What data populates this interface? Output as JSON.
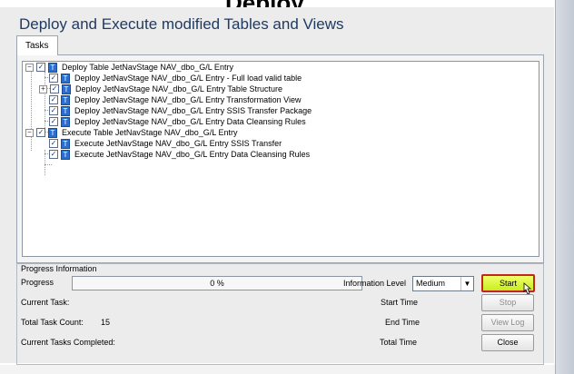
{
  "window": {
    "title": "Deploy and Execute modified Tables and Views",
    "top_cut_text": "Deploy"
  },
  "tabs": [
    {
      "label": "Tasks"
    }
  ],
  "tree": {
    "nodes": [
      {
        "label": "Deploy Table JetNavStage NAV_dbo_G/L Entry",
        "level": 0,
        "expander": "−",
        "checked": true
      },
      {
        "label": "Deploy JetNavStage NAV_dbo_G/L Entry - Full load valid table",
        "level": 1,
        "expander": "",
        "checked": true
      },
      {
        "label": "Deploy JetNavStage NAV_dbo_G/L Entry Table Structure",
        "level": 1,
        "expander": "+",
        "checked": true
      },
      {
        "label": "Deploy JetNavStage NAV_dbo_G/L Entry Transformation View",
        "level": 1,
        "expander": "",
        "checked": true
      },
      {
        "label": "Deploy JetNavStage NAV_dbo_G/L Entry SSIS Transfer Package",
        "level": 1,
        "expander": "",
        "checked": true
      },
      {
        "label": "Deploy JetNavStage NAV_dbo_G/L Entry Data Cleansing Rules",
        "level": 1,
        "expander": "",
        "checked": true
      },
      {
        "label": "Execute Table JetNavStage NAV_dbo_G/L Entry",
        "level": 0,
        "expander": "−",
        "checked": true
      },
      {
        "label": "Execute JetNavStage NAV_dbo_G/L Entry SSIS Transfer",
        "level": 1,
        "expander": "",
        "checked": true
      },
      {
        "label": "Execute JetNavStage NAV_dbo_G/L Entry Data Cleansing Rules",
        "level": 1,
        "expander": "",
        "checked": true
      }
    ]
  },
  "progress_info": {
    "group_title": "Progress Information",
    "progress_label": "Progress",
    "progress_text": "0 %",
    "progress_fraction": 0,
    "info_level_label": "Information Level",
    "info_level_value": "Medium",
    "current_task_label": "Current Task:",
    "total_task_count_label": "Total Task Count:",
    "total_task_count_value": "15",
    "current_tasks_completed_label": "Current Tasks Completed:",
    "start_time_label": "Start Time",
    "end_time_label": "End Time",
    "total_time_label": "Total Time"
  },
  "buttons": {
    "start": "Start",
    "stop": "Stop",
    "view_log": "View Log",
    "close": "Close"
  },
  "colors": {
    "title_text": "#1f3a63",
    "start_button_fill": "#d6f52a",
    "start_button_border": "#c2271f",
    "task_icon": "#2a6fd0"
  }
}
